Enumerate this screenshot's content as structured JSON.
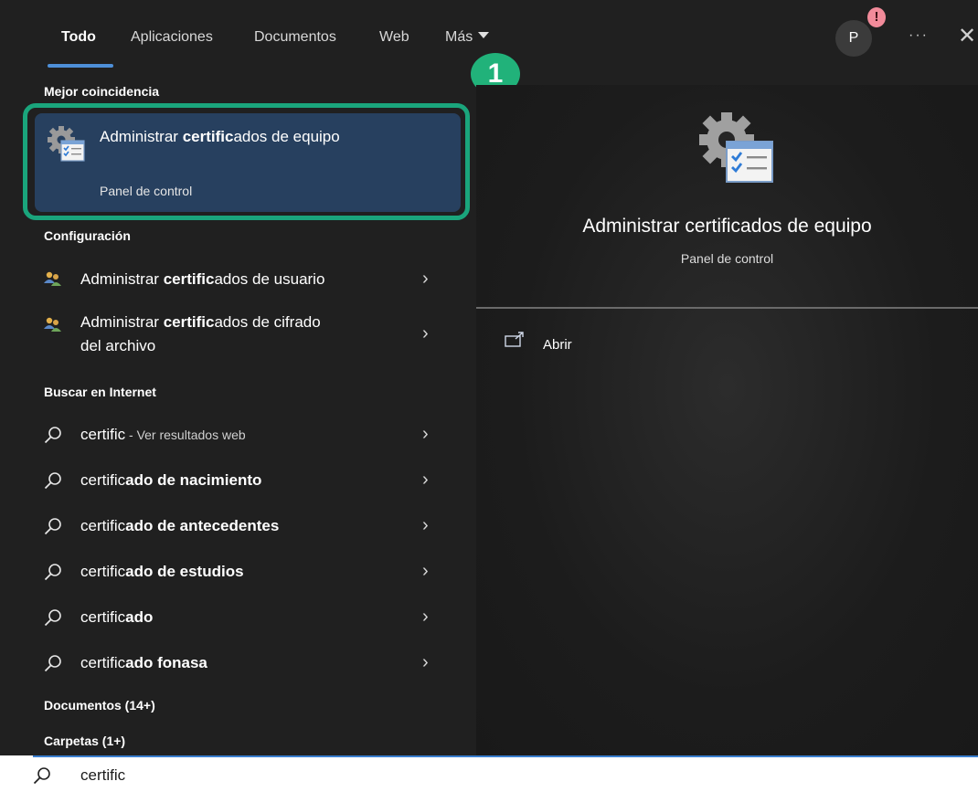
{
  "tabs": [
    {
      "label": "Todo",
      "active": true
    },
    {
      "label": "Aplicaciones"
    },
    {
      "label": "Documentos"
    },
    {
      "label": "Web"
    },
    {
      "label": "Más"
    }
  ],
  "header": {
    "avatar_initial": "P",
    "alert_badge": "!",
    "more_label": "···",
    "close_label": "✕"
  },
  "annotation": {
    "number": "1",
    "color": "#1aa57c"
  },
  "sections": {
    "best_match": "Mejor coincidencia",
    "settings": "Configuración",
    "web_search": "Buscar en Internet",
    "documents": "Documentos (14+)",
    "folders": "Carpetas (1+)"
  },
  "best_match": {
    "title_pre": "Administrar ",
    "title_bold": "certific",
    "title_post": "ados de equipo",
    "subtitle": "Panel de control",
    "icon": "certificate-manager-icon"
  },
  "settings_items": [
    {
      "pre": "Administrar ",
      "bold": "certific",
      "post": "ados de usuario",
      "icon": "users-icon"
    },
    {
      "pre": "Administrar ",
      "bold": "certific",
      "post": "ados de cifrado",
      "line2": "del archivo",
      "icon": "users-icon"
    }
  ],
  "web_items": [
    {
      "normal": "certific",
      "bold": "",
      "hint": " - Ver resultados web"
    },
    {
      "normal": "certific",
      "bold": "ado de nacimiento",
      "hint": ""
    },
    {
      "normal": "certific",
      "bold": "ado de antecedentes",
      "hint": ""
    },
    {
      "normal": "certific",
      "bold": "ado de estudios",
      "hint": ""
    },
    {
      "normal": "certific",
      "bold": "ado",
      "hint": ""
    },
    {
      "normal": "certific",
      "bold": "ado fonasa",
      "hint": ""
    }
  ],
  "preview": {
    "title": "Administrar certificados de equipo",
    "subtitle": "Panel de control",
    "open_label": "Abrir",
    "icon": "certificate-manager-icon"
  },
  "search": {
    "value": "certific",
    "icon": "search-icon"
  },
  "colors": {
    "panel_bg": "#202020",
    "highlight_bg": "#27405f",
    "accent_blue": "#4e8fd8",
    "annotation_green": "#1aa57c",
    "alert_badge": "#f28b9a"
  }
}
